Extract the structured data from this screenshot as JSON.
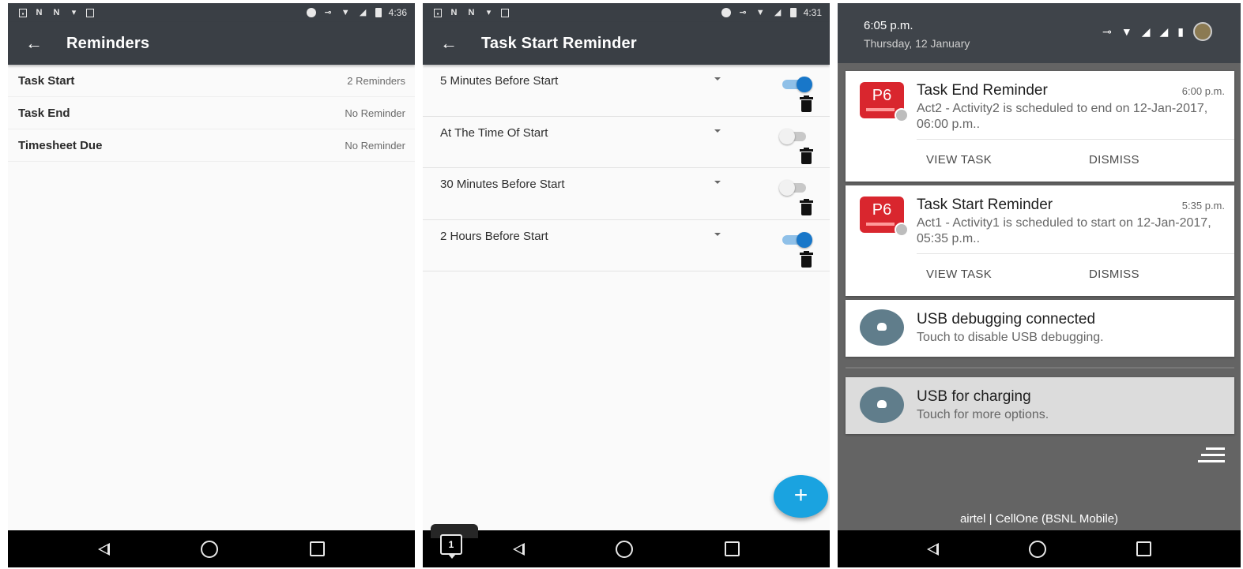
{
  "screen1": {
    "status": {
      "time": "4:36"
    },
    "title": "Reminders",
    "rows": [
      {
        "label": "Task Start",
        "value": "2 Reminders"
      },
      {
        "label": "Task End",
        "value": "No Reminder"
      },
      {
        "label": "Timesheet Due",
        "value": "No Reminder"
      }
    ]
  },
  "screen2": {
    "status": {
      "time": "4:31"
    },
    "title": "Task Start Reminder",
    "reminders": [
      {
        "label": "5 Minutes Before Start",
        "enabled": true
      },
      {
        "label": "At The Time Of Start",
        "enabled": false
      },
      {
        "label": "30 Minutes Before Start",
        "enabled": false
      },
      {
        "label": "2 Hours Before Start",
        "enabled": true
      }
    ],
    "fab_label": "+",
    "badge_count": "1"
  },
  "screen3": {
    "time": "6:05 p.m.",
    "date": "Thursday, 12 January",
    "notifications": [
      {
        "app_icon_text": "P6",
        "title": "Task End Reminder",
        "time": "6:00 p.m.",
        "body": "Act2 - Activity2 is scheduled to end on 12-Jan-2017, 06:00 p.m..",
        "action1": "VIEW TASK",
        "action2": "DISMISS"
      },
      {
        "app_icon_text": "P6",
        "title": "Task Start Reminder",
        "time": "5:35 p.m.",
        "body": "Act1 - Activity1 is scheduled to start on 12-Jan-2017, 05:35 p.m..",
        "action1": "VIEW TASK",
        "action2": "DISMISS"
      }
    ],
    "usb_debugging": {
      "title": "USB debugging connected",
      "body": "Touch to disable USB debugging."
    },
    "usb_charging": {
      "title": "USB for charging",
      "body": "Touch for more options."
    },
    "carrier": "airtel | CellOne (BSNL Mobile)"
  },
  "colors": {
    "appbar": "#3a3f45",
    "toggle_on": "#1877c9",
    "fab": "#1aa3e0",
    "p6_red": "#d9262e"
  },
  "icons": [
    "back-arrow-icon",
    "dropdown-caret-icon",
    "toggle-switch",
    "trash-icon",
    "add-icon",
    "nav-back-icon",
    "nav-home-icon",
    "nav-recents-icon",
    "usb-android-icon",
    "clear-all-icon",
    "vpn-key-icon",
    "wifi-icon",
    "signal-icon",
    "battery-icon"
  ]
}
